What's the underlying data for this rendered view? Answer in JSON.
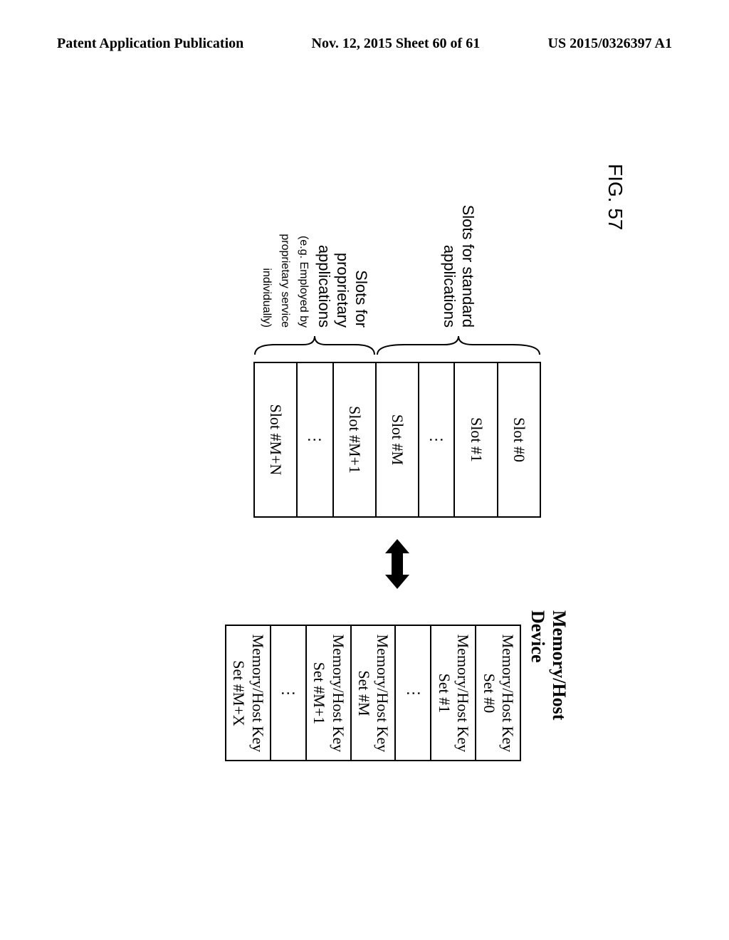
{
  "header": {
    "left": "Patent Application Publication",
    "center": "Nov. 12, 2015  Sheet 60 of 61",
    "right": "US 2015/0326397 A1"
  },
  "fig_label": "FIG. 57",
  "labels": {
    "standard": "Slots for standard applications",
    "proprietary_line1": "Slots for proprietary applications",
    "proprietary_line2": "(e.g. Employed by proprietary service individually)"
  },
  "device_title": "Memory/Host Device",
  "slots": {
    "s0": "Slot #0",
    "s1": "Slot #1",
    "dots1": "⋮",
    "sM": "Slot #M",
    "sM1": "Slot #M+1",
    "dots2": "⋮",
    "sMN": "Slot #M+N"
  },
  "keys": {
    "k0": "Memory/Host Key Set #0",
    "k1": "Memory/Host Key Set #1",
    "dots1": "⋮",
    "kM": "Memory/Host Key Set #M",
    "kM1": "Memory/Host Key Set #M+1",
    "dots2": "⋮",
    "kMX": "Memory/Host Key Set #M+X"
  }
}
